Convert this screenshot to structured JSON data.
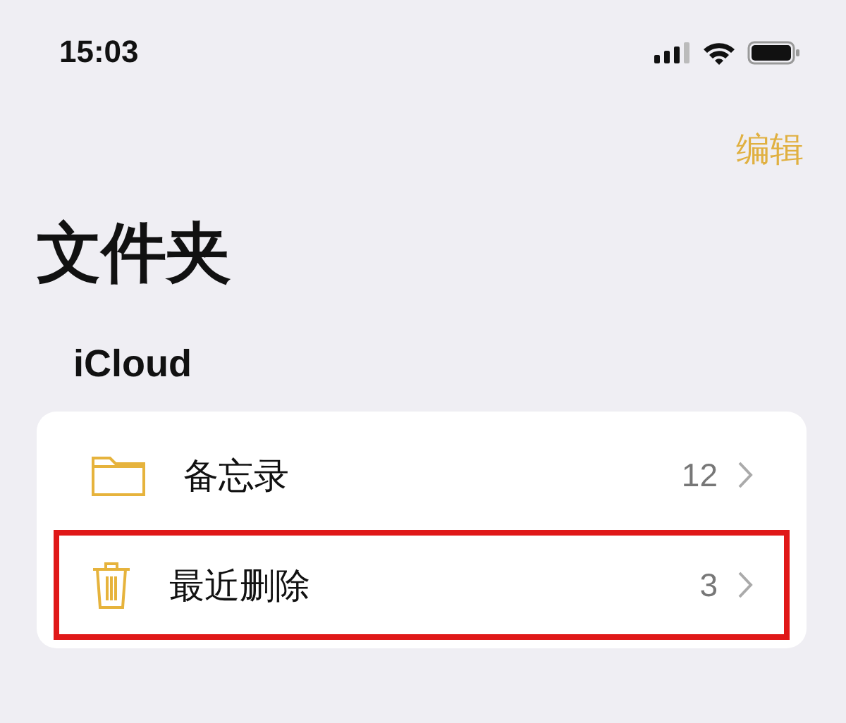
{
  "status_bar": {
    "time": "15:03"
  },
  "nav": {
    "edit": "编辑"
  },
  "title": "文件夹",
  "section": {
    "title": "iCloud",
    "items": [
      {
        "kind": "folder",
        "label": "备忘录",
        "count": "12",
        "highlighted": false
      },
      {
        "kind": "trash",
        "label": "最近删除",
        "count": "3",
        "highlighted": true
      }
    ]
  }
}
